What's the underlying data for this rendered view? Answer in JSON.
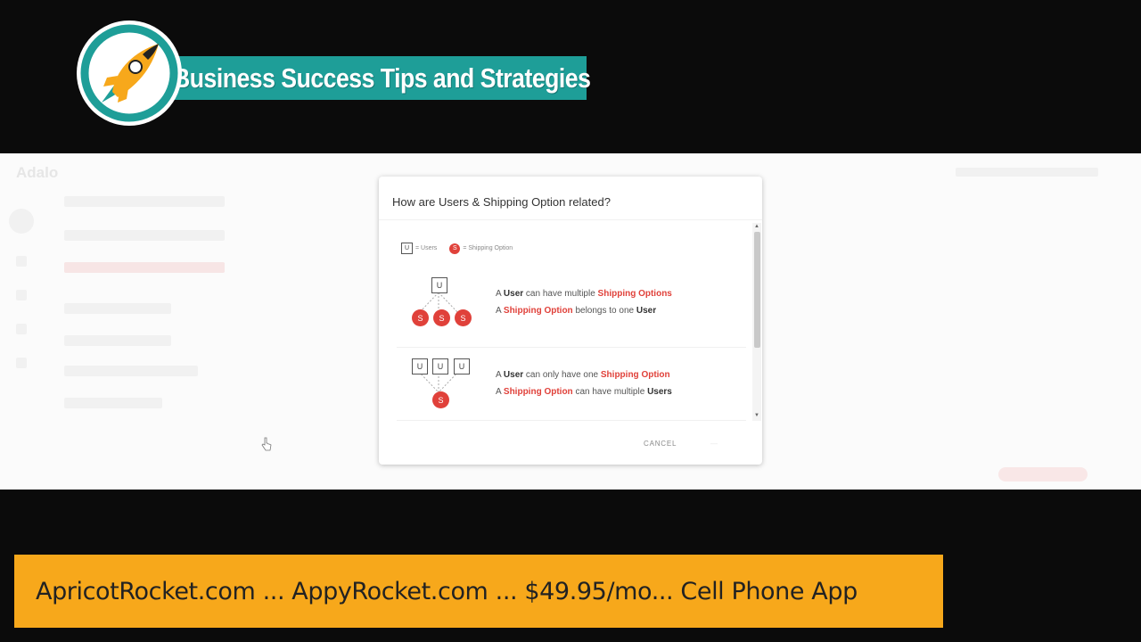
{
  "banner": {
    "title": "Business Success Tips and Strategies",
    "logo_icon": "rocket-icon",
    "teal": "#1e9e98"
  },
  "modal": {
    "title": "How are Users & Shipping Option related?",
    "legend": {
      "user_symbol": "U",
      "user_label": "= Users",
      "option_symbol": "S",
      "option_label": "= Shipping Option"
    },
    "relations": [
      {
        "diagram": {
          "top": [
            "U"
          ],
          "bottom": [
            "S",
            "S",
            "S"
          ]
        },
        "line1": {
          "a": "A ",
          "b": "User",
          "c": " can have multiple ",
          "d": "Shipping Options"
        },
        "line2": {
          "a": "A ",
          "b": "Shipping Option",
          "c": " belongs to one ",
          "d": "User"
        }
      },
      {
        "diagram": {
          "top": [
            "U",
            "U",
            "U"
          ],
          "bottom": [
            "S"
          ]
        },
        "line1": {
          "a": "A ",
          "b": "User",
          "c": " can only have one ",
          "d": "Shipping Option"
        },
        "line2": {
          "a": "A ",
          "b": "Shipping Option",
          "c": " can have multiple ",
          "d": "Users"
        }
      }
    ],
    "cancel_label": "CANCEL",
    "accent": "#e0413a"
  },
  "background_app": {
    "logo_text": "Adalo"
  },
  "ticker": {
    "text": "ApricotRocket.com ... AppyRocket.com ... $49.95/mo... Cell Phone App",
    "color": "#f7a81b"
  }
}
